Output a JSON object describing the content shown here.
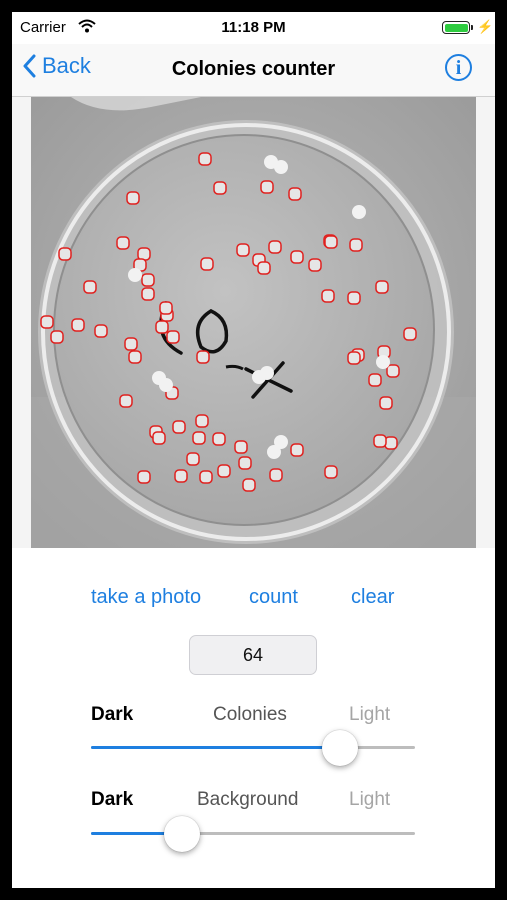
{
  "status_bar": {
    "carrier": "Carrier",
    "time": "11:18 PM"
  },
  "nav": {
    "back_label": "Back",
    "title": "Colonies counter",
    "info_glyph": "i"
  },
  "actions": {
    "take_photo": "take a photo",
    "count": "count",
    "clear": "clear"
  },
  "count_value": "64",
  "colonies_slider": {
    "dark_label": "Dark",
    "title": "Colonies",
    "light_label": "Light",
    "level": 0.77
  },
  "background_slider": {
    "dark_label": "Dark",
    "title": "Background",
    "light_label": "Light",
    "level": 0.28
  },
  "colors": {
    "accent": "#1e7fe0",
    "marker": "#e0201e"
  }
}
